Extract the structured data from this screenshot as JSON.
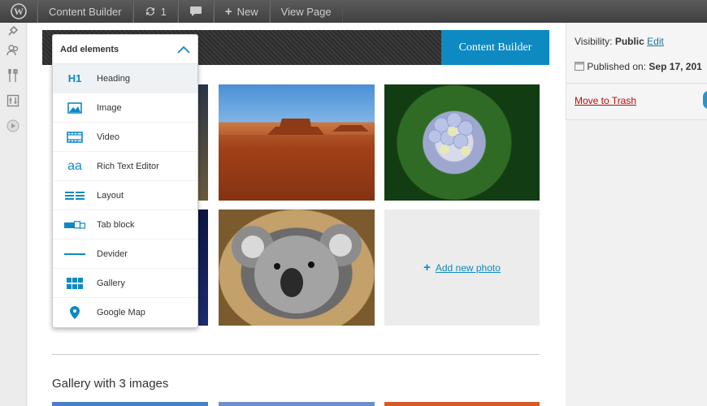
{
  "adminbar": {
    "site_name": "Content Builder",
    "updates_count": "1",
    "new_label": "New",
    "view_page_label": "View Page"
  },
  "builder": {
    "button_label": "Content Builder"
  },
  "dropdown": {
    "title": "Add elements",
    "items": [
      {
        "label": "Heading",
        "icon": "H1"
      },
      {
        "label": "Image",
        "icon": "image-icon"
      },
      {
        "label": "Video",
        "icon": "video-icon"
      },
      {
        "label": "Rich Text Editor",
        "icon": "aa"
      },
      {
        "label": "Layout",
        "icon": "layout-icon"
      },
      {
        "label": "Tab block",
        "icon": "tab-block-icon"
      },
      {
        "label": "Devider",
        "icon": "divider-icon"
      },
      {
        "label": "Gallery",
        "icon": "gallery-icon"
      },
      {
        "label": "Google Map",
        "icon": "map-pin-icon"
      }
    ]
  },
  "gallery": {
    "add_photo_label": "Add new photo",
    "next_title": "Gallery with 3 images"
  },
  "publish": {
    "visibility_label": "Visibility:",
    "visibility_value": "Public",
    "edit_label": "Edit",
    "published_label": "Published on:",
    "published_date": "Sep 17, 201",
    "trash_label": "Move to Trash"
  },
  "colors": {
    "accent": "#0e8ac3",
    "adminbar": "#464646",
    "trash": "#bc0b0b"
  }
}
